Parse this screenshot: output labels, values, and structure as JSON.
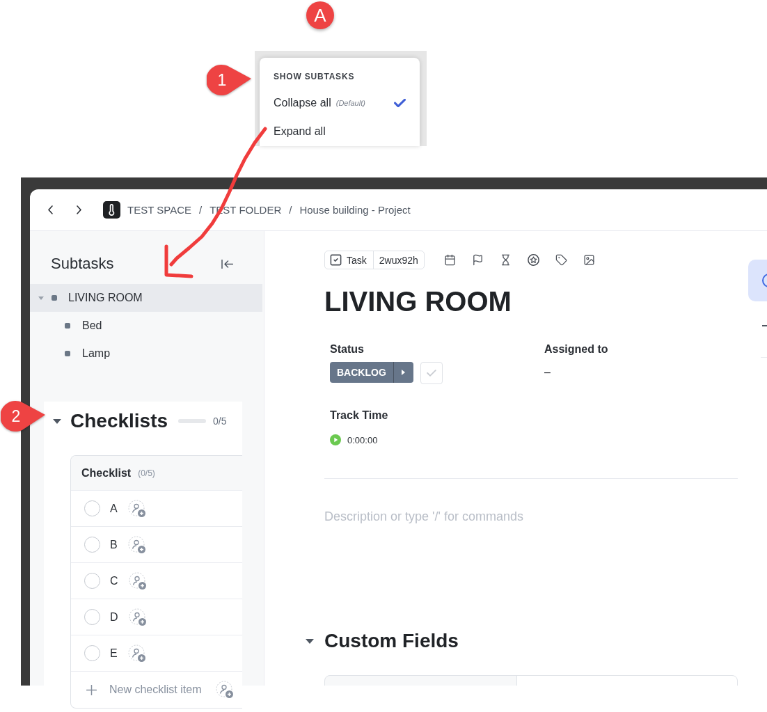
{
  "annotations": {
    "letter_badge": "A"
  },
  "subtasks_menu": {
    "step_badge": "1",
    "heading": "SHOW SUBTASKS",
    "options": [
      {
        "label": "Collapse all",
        "note": "(Default)",
        "selected": true
      },
      {
        "label": "Expand all",
        "selected": false
      }
    ]
  },
  "window": {
    "breadcrumb": [
      {
        "kind": "crumb",
        "label": "TEST SPACE"
      },
      {
        "kind": "separator",
        "label": "/"
      },
      {
        "kind": "crumb",
        "label": "TEST FOLDER"
      },
      {
        "kind": "separator",
        "label": "/"
      },
      {
        "kind": "crumb",
        "label": "House building - Project"
      }
    ]
  },
  "sidebar": {
    "title": "Subtasks",
    "tree": [
      {
        "label": "LIVING ROOM",
        "selected": true,
        "expanded": true,
        "children": [
          {
            "label": "Bed",
            "selected": false
          },
          {
            "label": "Lamp",
            "selected": false
          }
        ]
      }
    ]
  },
  "checklists": {
    "step_badge": "2",
    "title": "Checklists",
    "expanded": true,
    "level": 0,
    "count": "0/5",
    "checklist": {
      "title": "Checklist",
      "count": "(0/5)",
      "items": [
        {
          "label": "A",
          "checked": false
        },
        {
          "label": "B",
          "checked": false
        },
        {
          "label": "C",
          "checked": false
        },
        {
          "label": "D",
          "checked": false
        },
        {
          "label": "E",
          "checked": false
        }
      ],
      "new_item": {
        "placeholder": "New checklist item"
      }
    }
  },
  "task": {
    "type": "Task",
    "id": "2wux92h",
    "title": "LIVING ROOM",
    "fields": [
      {
        "kind": "status",
        "label": "Status",
        "value": "BACKLOG",
        "done": false
      },
      {
        "kind": "person",
        "label": "Assigned to",
        "value": "–"
      },
      {
        "kind": "timer",
        "label": "Track Time",
        "value": "0:00:00"
      }
    ],
    "description": {
      "placeholder": "Description or type '/' for commands"
    },
    "custom_fields": {
      "title": "Custom Fields",
      "expanded": true
    }
  }
}
